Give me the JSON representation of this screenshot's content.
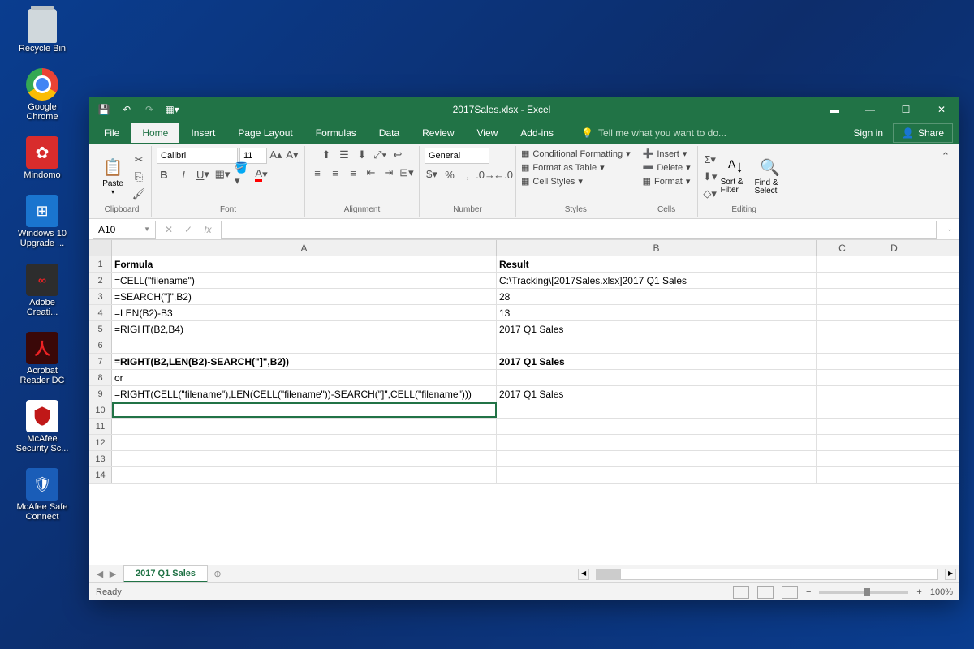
{
  "desktop": {
    "icons": [
      {
        "label": "Recycle Bin",
        "name": "recycle-bin"
      },
      {
        "label": "Google Chrome",
        "name": "google-chrome"
      },
      {
        "label": "Mindomo",
        "name": "mindomo"
      },
      {
        "label": "Windows 10 Upgrade ...",
        "name": "win10-upgrade"
      },
      {
        "label": "Adobe Creati...",
        "name": "adobe-cc"
      },
      {
        "label": "Acrobat Reader DC",
        "name": "acrobat-reader"
      },
      {
        "label": "McAfee Security Sc...",
        "name": "mcafee-security"
      },
      {
        "label": "McAfee Safe Connect",
        "name": "mcafee-safe-connect"
      }
    ]
  },
  "excel": {
    "title": "2017Sales.xlsx - Excel",
    "tabs": [
      "File",
      "Home",
      "Insert",
      "Page Layout",
      "Formulas",
      "Data",
      "Review",
      "View",
      "Add-ins"
    ],
    "active_tab": "Home",
    "tellme": "Tell me what you want to do...",
    "signin": "Sign in",
    "share": "Share",
    "ribbon": {
      "clipboard": "Clipboard",
      "paste": "Paste",
      "font": "Font",
      "font_name": "Calibri",
      "font_size": "11",
      "alignment": "Alignment",
      "number": "Number",
      "number_format": "General",
      "styles": "Styles",
      "cond_fmt": "Conditional Formatting",
      "fmt_table": "Format as Table",
      "cell_styles": "Cell Styles",
      "cells": "Cells",
      "insert": "Insert",
      "delete": "Delete",
      "format": "Format",
      "editing": "Editing",
      "sort": "Sort & Filter",
      "find": "Find & Select"
    },
    "name_box": "A10",
    "formula_input": "",
    "columns": [
      "A",
      "B",
      "C",
      "D"
    ],
    "rows": [
      {
        "n": 1,
        "a": "Formula",
        "b": "Result",
        "bold": true
      },
      {
        "n": 2,
        "a": "=CELL(\"filename\")",
        "b": "C:\\Tracking\\[2017Sales.xlsx]2017 Q1 Sales"
      },
      {
        "n": 3,
        "a": "=SEARCH(\"]\",B2)",
        "b": "28"
      },
      {
        "n": 4,
        "a": "=LEN(B2)-B3",
        "b": "13"
      },
      {
        "n": 5,
        "a": "=RIGHT(B2,B4)",
        "b": "2017 Q1 Sales"
      },
      {
        "n": 6,
        "a": "",
        "b": ""
      },
      {
        "n": 7,
        "a": "=RIGHT(B2,LEN(B2)-SEARCH(\"]\",B2))",
        "b": "2017 Q1 Sales",
        "bold": true
      },
      {
        "n": 8,
        "a": "or",
        "b": ""
      },
      {
        "n": 9,
        "a": "=RIGHT(CELL(\"filename\"),LEN(CELL(\"filename\"))-SEARCH(\"]\",CELL(\"filename\")))",
        "b": "2017 Q1 Sales"
      },
      {
        "n": 10,
        "a": "",
        "b": "",
        "active": true
      },
      {
        "n": 11,
        "a": "",
        "b": ""
      },
      {
        "n": 12,
        "a": "",
        "b": ""
      },
      {
        "n": 13,
        "a": "",
        "b": ""
      },
      {
        "n": 14,
        "a": "",
        "b": ""
      }
    ],
    "sheet_tab": "2017 Q1 Sales",
    "status": "Ready",
    "zoom": "100%"
  }
}
